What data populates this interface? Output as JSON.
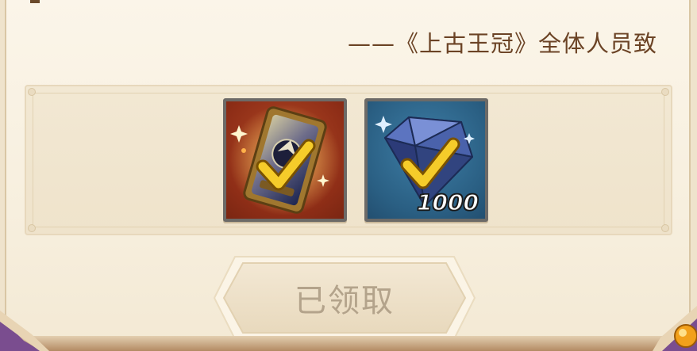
{
  "letter": {
    "signature": "——《上古王冠》全体人员致"
  },
  "rewards": [
    {
      "name": "card-frame",
      "icon": "card-frame-icon",
      "claimed": true,
      "quantity": ""
    },
    {
      "name": "diamond",
      "icon": "diamond-icon",
      "claimed": true,
      "quantity": "1000"
    }
  ],
  "claim_button": {
    "label": "已领取",
    "state": "disabled"
  },
  "colors": {
    "paper": "#f6eedd",
    "signature_text": "#6b4325",
    "button_text_disabled": "#b3a38b",
    "check": "#f5cc2a"
  }
}
